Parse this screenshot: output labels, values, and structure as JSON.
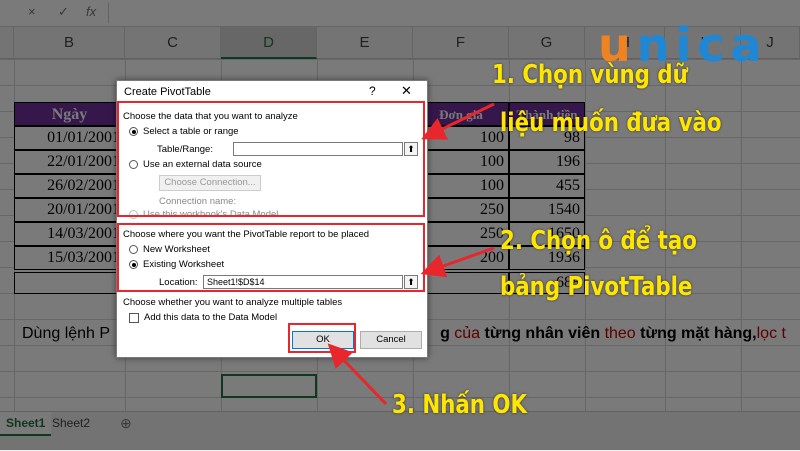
{
  "formula_bar": {
    "cancel_icon": "×",
    "enter_icon": "✓",
    "fx_label": "fx"
  },
  "columns": [
    "B",
    "C",
    "D",
    "E",
    "F",
    "G",
    "H",
    "I",
    "J"
  ],
  "table": {
    "header_left": "Ngày",
    "header_mid": "Đơn giá",
    "header_right": "Thành tiền",
    "rows": [
      {
        "date": "01/01/2001",
        "price": "100",
        "amount": "98"
      },
      {
        "date": "22/01/2001",
        "price": "100",
        "amount": "196"
      },
      {
        "date": "26/02/2001",
        "price": "100",
        "amount": "455"
      },
      {
        "date": "20/01/2001",
        "price": "250",
        "amount": "1540"
      },
      {
        "date": "14/03/2001",
        "price": "250",
        "amount": "1650"
      },
      {
        "date": "15/03/2001",
        "price": "200",
        "amount": "1936"
      }
    ],
    "total_partial": "688"
  },
  "note_text": {
    "left": "Dùng lệnh P",
    "part1": "g ",
    "part2": "của",
    "part3": " từng nhân viên ",
    "part4": "theo",
    "part5": " từng mặt hàng,",
    "part6": "lọc t"
  },
  "sheet_tabs": [
    "Sheet1",
    "Sheet2"
  ],
  "add_sheet_icon": "⊕",
  "dialog": {
    "title": "Create PivotTable",
    "help": "?",
    "close": "✕",
    "section1_label": "Choose the data that you want to analyze",
    "select_table_label": "Select a table or range",
    "table_range_label": "Table/Range:",
    "table_range_value": "",
    "external_source_label": "Use an external data source",
    "choose_connection_label": "Choose Connection...",
    "connection_name_label": "Connection name:",
    "data_model_label": "Use this workbook's Data Model",
    "section2_label": "Choose where you want the PivotTable report to be placed",
    "new_worksheet_label": "New Worksheet",
    "existing_worksheet_label": "Existing Worksheet",
    "location_label": "Location:",
    "location_value": "Sheet1!$D$14",
    "section3_label": "Choose whether you want to analyze multiple tables",
    "add_data_model_label": "Add this data to the Data Model",
    "ok_label": "OK",
    "cancel_label": "Cancel"
  },
  "annotations": {
    "step1_line1": "1. Chọn vùng dữ",
    "step1_line2": "liệu muốn đưa vào",
    "step2_line1": "2. Chọn ô để tạo",
    "step2_line2": "bảng PivotTable",
    "step3": "3. Nhấn OK",
    "annotation_color": "#ffe600",
    "highlight_color": "#e8262b"
  },
  "logo": {
    "text": "unica",
    "colors": [
      "#f08321",
      "#1e88d6"
    ]
  }
}
